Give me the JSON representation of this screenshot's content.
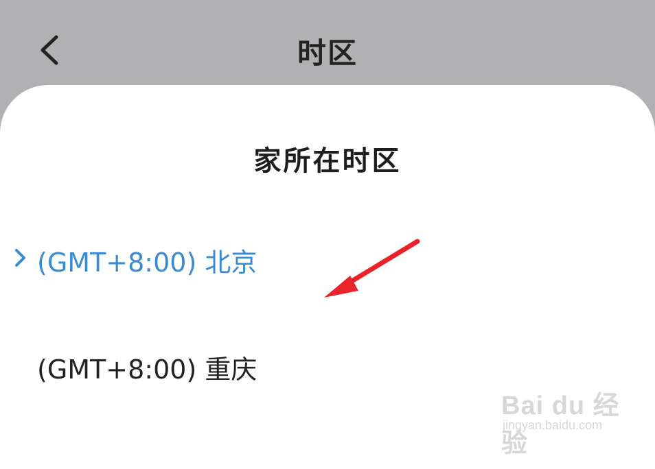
{
  "header": {
    "title": "时区",
    "back_icon": "chevron-left-icon"
  },
  "sheet": {
    "title": "家所在时区",
    "options": [
      {
        "label": "(GMT+8:00) 北京",
        "selected": true,
        "indicator_icon": "chevron-right-icon",
        "color": "#3a8bd1"
      },
      {
        "label": "(GMT+8:00) 重庆",
        "selected": false,
        "color": "#222222"
      }
    ]
  },
  "annotation": {
    "icon": "red-arrow-icon",
    "color": "#e8232a"
  },
  "watermark": {
    "logo": "Bai du 经验",
    "url": "jingyan.baidu.com"
  },
  "colors": {
    "header_background": "#b1b1b3",
    "sheet_background": "#ffffff",
    "accent": "#3a8bd1"
  }
}
